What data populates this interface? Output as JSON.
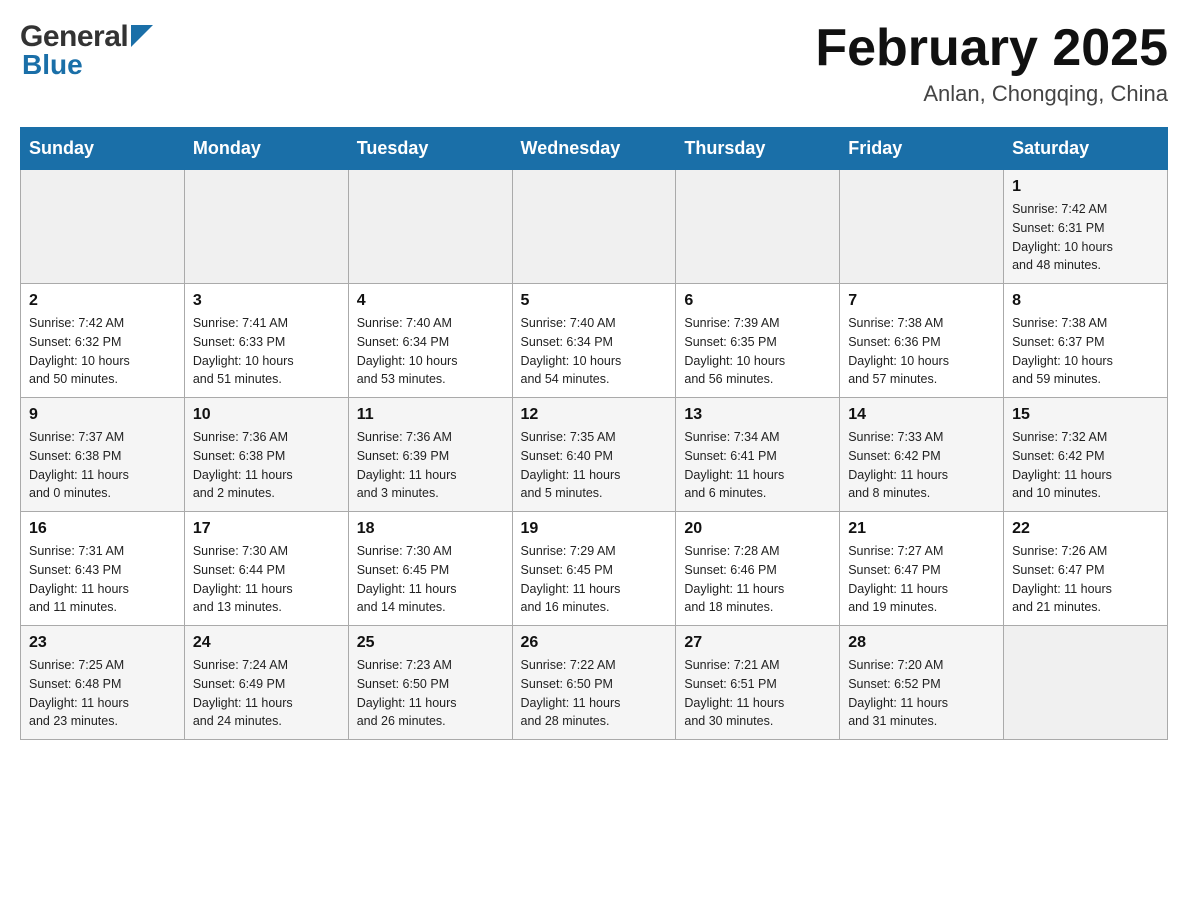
{
  "header": {
    "logo_general": "General",
    "logo_blue": "Blue",
    "month_title": "February 2025",
    "location": "Anlan, Chongqing, China"
  },
  "days_of_week": [
    "Sunday",
    "Monday",
    "Tuesday",
    "Wednesday",
    "Thursday",
    "Friday",
    "Saturday"
  ],
  "weeks": [
    {
      "row_bg": "light",
      "days": [
        {
          "num": "",
          "info": ""
        },
        {
          "num": "",
          "info": ""
        },
        {
          "num": "",
          "info": ""
        },
        {
          "num": "",
          "info": ""
        },
        {
          "num": "",
          "info": ""
        },
        {
          "num": "",
          "info": ""
        },
        {
          "num": "1",
          "info": "Sunrise: 7:42 AM\nSunset: 6:31 PM\nDaylight: 10 hours\nand 48 minutes."
        }
      ]
    },
    {
      "row_bg": "white",
      "days": [
        {
          "num": "2",
          "info": "Sunrise: 7:42 AM\nSunset: 6:32 PM\nDaylight: 10 hours\nand 50 minutes."
        },
        {
          "num": "3",
          "info": "Sunrise: 7:41 AM\nSunset: 6:33 PM\nDaylight: 10 hours\nand 51 minutes."
        },
        {
          "num": "4",
          "info": "Sunrise: 7:40 AM\nSunset: 6:34 PM\nDaylight: 10 hours\nand 53 minutes."
        },
        {
          "num": "5",
          "info": "Sunrise: 7:40 AM\nSunset: 6:34 PM\nDaylight: 10 hours\nand 54 minutes."
        },
        {
          "num": "6",
          "info": "Sunrise: 7:39 AM\nSunset: 6:35 PM\nDaylight: 10 hours\nand 56 minutes."
        },
        {
          "num": "7",
          "info": "Sunrise: 7:38 AM\nSunset: 6:36 PM\nDaylight: 10 hours\nand 57 minutes."
        },
        {
          "num": "8",
          "info": "Sunrise: 7:38 AM\nSunset: 6:37 PM\nDaylight: 10 hours\nand 59 minutes."
        }
      ]
    },
    {
      "row_bg": "light",
      "days": [
        {
          "num": "9",
          "info": "Sunrise: 7:37 AM\nSunset: 6:38 PM\nDaylight: 11 hours\nand 0 minutes."
        },
        {
          "num": "10",
          "info": "Sunrise: 7:36 AM\nSunset: 6:38 PM\nDaylight: 11 hours\nand 2 minutes."
        },
        {
          "num": "11",
          "info": "Sunrise: 7:36 AM\nSunset: 6:39 PM\nDaylight: 11 hours\nand 3 minutes."
        },
        {
          "num": "12",
          "info": "Sunrise: 7:35 AM\nSunset: 6:40 PM\nDaylight: 11 hours\nand 5 minutes."
        },
        {
          "num": "13",
          "info": "Sunrise: 7:34 AM\nSunset: 6:41 PM\nDaylight: 11 hours\nand 6 minutes."
        },
        {
          "num": "14",
          "info": "Sunrise: 7:33 AM\nSunset: 6:42 PM\nDaylight: 11 hours\nand 8 minutes."
        },
        {
          "num": "15",
          "info": "Sunrise: 7:32 AM\nSunset: 6:42 PM\nDaylight: 11 hours\nand 10 minutes."
        }
      ]
    },
    {
      "row_bg": "white",
      "days": [
        {
          "num": "16",
          "info": "Sunrise: 7:31 AM\nSunset: 6:43 PM\nDaylight: 11 hours\nand 11 minutes."
        },
        {
          "num": "17",
          "info": "Sunrise: 7:30 AM\nSunset: 6:44 PM\nDaylight: 11 hours\nand 13 minutes."
        },
        {
          "num": "18",
          "info": "Sunrise: 7:30 AM\nSunset: 6:45 PM\nDaylight: 11 hours\nand 14 minutes."
        },
        {
          "num": "19",
          "info": "Sunrise: 7:29 AM\nSunset: 6:45 PM\nDaylight: 11 hours\nand 16 minutes."
        },
        {
          "num": "20",
          "info": "Sunrise: 7:28 AM\nSunset: 6:46 PM\nDaylight: 11 hours\nand 18 minutes."
        },
        {
          "num": "21",
          "info": "Sunrise: 7:27 AM\nSunset: 6:47 PM\nDaylight: 11 hours\nand 19 minutes."
        },
        {
          "num": "22",
          "info": "Sunrise: 7:26 AM\nSunset: 6:47 PM\nDaylight: 11 hours\nand 21 minutes."
        }
      ]
    },
    {
      "row_bg": "light",
      "days": [
        {
          "num": "23",
          "info": "Sunrise: 7:25 AM\nSunset: 6:48 PM\nDaylight: 11 hours\nand 23 minutes."
        },
        {
          "num": "24",
          "info": "Sunrise: 7:24 AM\nSunset: 6:49 PM\nDaylight: 11 hours\nand 24 minutes."
        },
        {
          "num": "25",
          "info": "Sunrise: 7:23 AM\nSunset: 6:50 PM\nDaylight: 11 hours\nand 26 minutes."
        },
        {
          "num": "26",
          "info": "Sunrise: 7:22 AM\nSunset: 6:50 PM\nDaylight: 11 hours\nand 28 minutes."
        },
        {
          "num": "27",
          "info": "Sunrise: 7:21 AM\nSunset: 6:51 PM\nDaylight: 11 hours\nand 30 minutes."
        },
        {
          "num": "28",
          "info": "Sunrise: 7:20 AM\nSunset: 6:52 PM\nDaylight: 11 hours\nand 31 minutes."
        },
        {
          "num": "",
          "info": ""
        }
      ]
    }
  ]
}
